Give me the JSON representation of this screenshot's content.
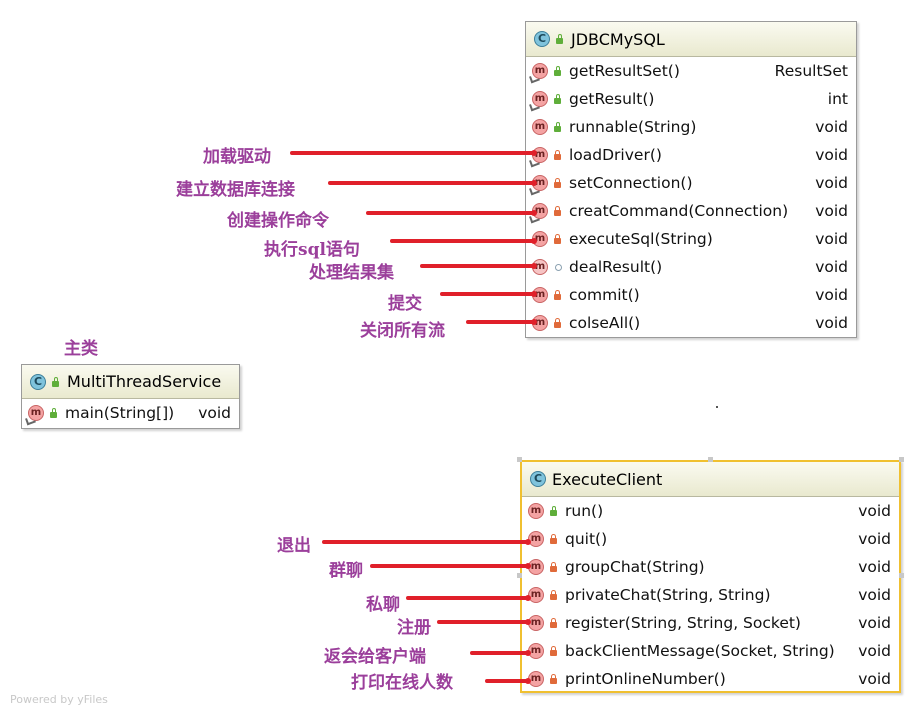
{
  "classes": {
    "jdbc": {
      "name": "JDBCMySQL",
      "methods": [
        {
          "name": "getResultSet()",
          "type": "ResultSet",
          "vis": "pub",
          "sync": true
        },
        {
          "name": "getResult()",
          "type": "int",
          "vis": "pub",
          "sync": true
        },
        {
          "name": "runnable(String)",
          "type": "void",
          "vis": "pub",
          "sync": false
        },
        {
          "name": "loadDriver()",
          "type": "void",
          "vis": "priv",
          "sync": true
        },
        {
          "name": "setConnection()",
          "type": "void",
          "vis": "priv",
          "sync": true
        },
        {
          "name": "creatCommand(Connection)",
          "type": "void",
          "vis": "priv",
          "sync": true
        },
        {
          "name": "executeSql(String)",
          "type": "void",
          "vis": "priv",
          "sync": false
        },
        {
          "name": "dealResult()",
          "type": "void",
          "vis": "pkgv",
          "sync": false
        },
        {
          "name": "commit()",
          "type": "void",
          "vis": "priv",
          "sync": false
        },
        {
          "name": "colseAll()",
          "type": "void",
          "vis": "priv",
          "sync": false
        }
      ]
    },
    "main": {
      "name": "MultiThreadService",
      "methods": [
        {
          "name": "main(String[])",
          "type": "void",
          "vis": "pub",
          "sync": true
        }
      ]
    },
    "client": {
      "name": "ExecuteClient",
      "methods": [
        {
          "name": "run()",
          "type": "void",
          "vis": "pub",
          "sync": false
        },
        {
          "name": "quit()",
          "type": "void",
          "vis": "priv",
          "sync": false
        },
        {
          "name": "groupChat(String)",
          "type": "void",
          "vis": "priv",
          "sync": false
        },
        {
          "name": "privateChat(String, String)",
          "type": "void",
          "vis": "priv",
          "sync": false
        },
        {
          "name": "register(String, String, Socket)",
          "type": "void",
          "vis": "priv",
          "sync": false
        },
        {
          "name": "backClientMessage(Socket, String)",
          "type": "void",
          "vis": "priv",
          "sync": false
        },
        {
          "name": "printOnlineNumber()",
          "type": "void",
          "vis": "priv",
          "sync": false
        }
      ]
    }
  },
  "icons": {
    "class_letter": "C",
    "method_letter": "m"
  },
  "annotations": {
    "main_class": "主类",
    "jdbc": [
      "加载驱动",
      "建立数据库连接",
      "创建操作命令",
      "执行sql语句",
      "处理结果集",
      "提交",
      "关闭所有流"
    ],
    "client": [
      "退出",
      "群聊",
      "私聊",
      "注册",
      "返会给客户端",
      "打印在线人数"
    ]
  },
  "footer": "Powered by yFiles",
  "colors": {
    "annotation_text": "#9b3f9b",
    "annotation_line": "#e0202a",
    "selection_border": "#f0c030"
  }
}
